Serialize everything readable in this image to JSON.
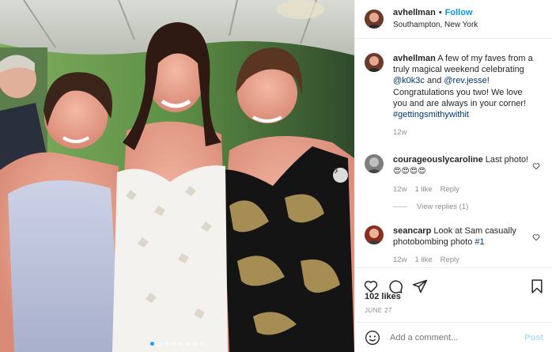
{
  "post": {
    "username": "avhellman",
    "separator": "•",
    "follow_label": "Follow",
    "location": "Southampton, New York"
  },
  "caption": {
    "username": "avhellman",
    "text_before": "A few of my faves from a truly magical weekend celebrating",
    "mention_1": "@k0k3c",
    "and": "and",
    "mention_2": "@rev.jesse",
    "text_after": "! Congratulations you two! We love you and are always in your corner!",
    "hashtag": "#gettingsmithywithit",
    "time": "12w"
  },
  "comments": [
    {
      "username": "courageouslycaroline",
      "text": "Last photo!",
      "emoji": "😍😍😍😍",
      "time": "12w",
      "likes": "1 like",
      "reply": "Reply",
      "view_replies": "View replies (1)"
    },
    {
      "username": "seancarp",
      "text": "Look at Sam casually photobombing photo",
      "tag": "#1",
      "time": "12w",
      "likes": "1 like",
      "reply": "Reply"
    }
  ],
  "likes_count": "102 likes",
  "post_date": "JUNE 27",
  "add_comment": {
    "placeholder": "Add a comment...",
    "post_label": "Post"
  },
  "carousel": {
    "slide_count": 8,
    "active_index": 0
  },
  "colors": {
    "link_blue": "#0095f6",
    "mention_blue": "#00376b",
    "muted_gray": "#8e8e8e",
    "post_disabled": "#b2dffc"
  },
  "icons": [
    "heart-icon",
    "comment-icon",
    "share-icon",
    "bookmark-icon",
    "emoji-icon",
    "chevron-right-icon"
  ]
}
